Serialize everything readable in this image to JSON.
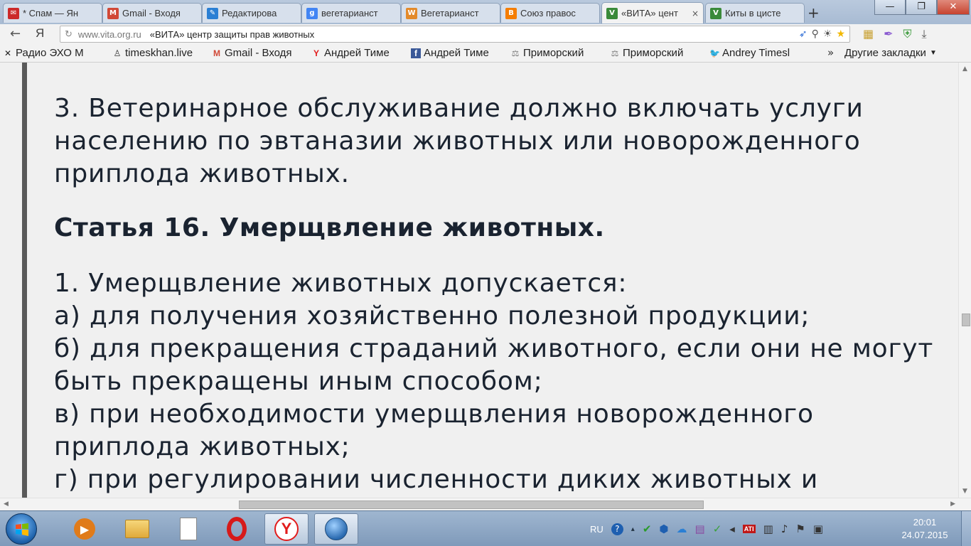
{
  "tabs": [
    {
      "title": "* Спам — Ян",
      "icon": "envelope-icon",
      "color": "#cc2a2a"
    },
    {
      "title": "Gmail - Входя",
      "icon": "gmail-icon",
      "color": "#d14836"
    },
    {
      "title": "Редактирова",
      "icon": "edit-icon",
      "color": "#2a7fd4"
    },
    {
      "title": "вегетарианст",
      "icon": "google-icon",
      "color": "#4285f4"
    },
    {
      "title": "Вегетарианст",
      "icon": "wiki-icon",
      "color": "#e38a2a"
    },
    {
      "title": "Союз правос",
      "icon": "blogger-icon",
      "color": "#f57d00"
    },
    {
      "title": "«ВИТА» цент",
      "icon": "vita-icon",
      "color": "#3a8a3a",
      "active": true
    },
    {
      "title": "Киты в цисте",
      "icon": "vita-icon",
      "color": "#3a8a3a"
    }
  ],
  "tab_close_glyph": "×",
  "new_tab_glyph": "+",
  "window_controls": {
    "minimize": "—",
    "restore": "❐",
    "close": "✕"
  },
  "toolbar": {
    "back_glyph": "←",
    "yandex_logo": "Я",
    "omnibox_icon": "↻",
    "host": "www.vita.org.ru",
    "page_title": "«ВИТА» центр защиты прав животных"
  },
  "bookmarks": [
    {
      "label": "Радио ЭХО М",
      "icon": "echo-icon"
    },
    {
      "label": "timeskhan.live",
      "icon": "user-icon"
    },
    {
      "label": "Gmail - Входя",
      "icon": "gmail-icon"
    },
    {
      "label": "Андрей Тиме",
      "icon": "yandex-icon"
    },
    {
      "label": "Андрей Тиме",
      "icon": "facebook-icon"
    },
    {
      "label": "Приморский",
      "icon": "scales-icon"
    },
    {
      "label": "Приморский",
      "icon": "scales-icon"
    },
    {
      "label": "Andrey Timesl",
      "icon": "twitter-icon"
    }
  ],
  "bookmarks_more": "»",
  "other_bookmarks": "Другие закладки",
  "article": {
    "para3": "3. Ветеринарное обслуживание должно включать услуги населению по эвтаназии животных или новорожденного приплода животных.",
    "heading": "Статья 16. Умерщвление животных.",
    "item1": "1. Умерщвление животных допускается:",
    "item_a": "а) для получения хозяйственно полезной продукции;",
    "item_b": "б) для прекращения страданий животного, если они не могут быть прекращены иным способом;",
    "item_v": "в) при необходимости умерщвления новорожденного приплода животных;",
    "item_g": "г) при регулировании численности диких животных и"
  },
  "taskbar": {
    "apps": [
      {
        "name": "media-player-icon",
        "glyph": "▶",
        "color": "#e07b1a"
      },
      {
        "name": "folder-icon",
        "glyph": "📁",
        "color": "#e5b93b"
      },
      {
        "name": "document-icon",
        "glyph": "📄",
        "color": "#ffffff"
      },
      {
        "name": "opera-icon",
        "glyph": "O",
        "color": "#d61a1a"
      },
      {
        "name": "yandex-browser-icon",
        "glyph": "Y",
        "color": "#e21b1b",
        "active": true
      },
      {
        "name": "network-globe-icon",
        "glyph": "🌐",
        "color": "#2a6ab0",
        "active": true
      }
    ],
    "language": "RU",
    "clock_time": "20:01",
    "clock_date": "24.07.2015"
  }
}
